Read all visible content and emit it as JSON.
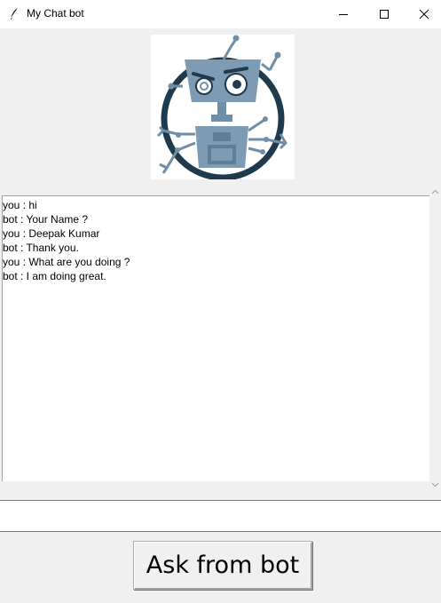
{
  "window": {
    "title": "My Chat bot",
    "icon": "feather-icon",
    "controls": [
      "minimize-icon",
      "maximize-icon",
      "close-icon"
    ]
  },
  "logo": {
    "icon": "robot-icon",
    "colors": {
      "body": "#7d9bb3",
      "dark": "#1f3a4d"
    }
  },
  "chat": {
    "messages": [
      "you : hi",
      "bot : Your Name ?",
      "you : Deepak Kumar",
      "bot : Thank you.",
      "you : What are you doing ?",
      "bot : I am doing great."
    ]
  },
  "input": {
    "value": ""
  },
  "ask_button": {
    "label": "Ask from bot"
  }
}
